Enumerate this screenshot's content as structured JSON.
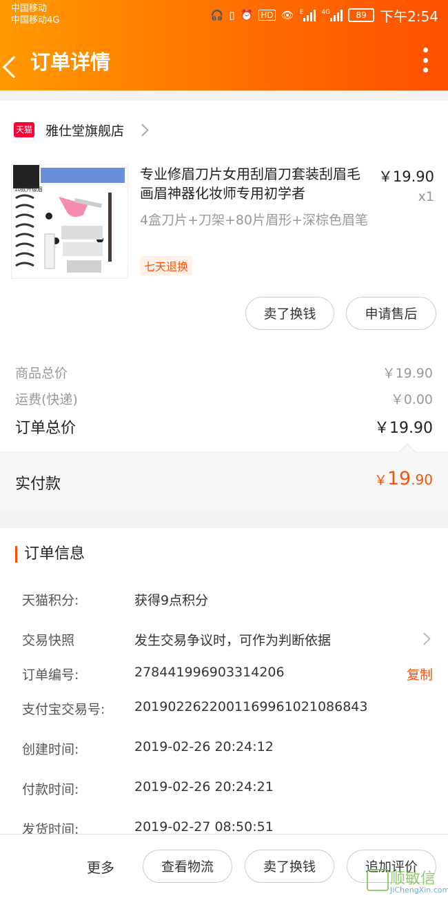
{
  "status_bar": {
    "carrier_1": "中国移动",
    "carrier_2": "中国移动4G",
    "hd": "HD",
    "net_e": "E",
    "net_4g": "4G",
    "battery": "89",
    "time": "下午2:54"
  },
  "nav": {
    "title": "订单详情"
  },
  "shop": {
    "badge": "天猫",
    "name": "雅仕堂旗舰店"
  },
  "product": {
    "title": "专业修眉刀片女用刮眉刀套装刮眉毛画眉神器化妆师专用初学者",
    "sku": "4盒刀片+刀架+80片眉形+深棕色眉笔",
    "tag": "七天退换",
    "price": "￥19.90",
    "qty": "x1",
    "image_text": "10款升级眉"
  },
  "item_actions": {
    "sell": "卖了换钱",
    "aftersale": "申请售后"
  },
  "summary": {
    "goods_label": "商品总价",
    "goods_value": "￥19.90",
    "shipping_label": "运费(快递)",
    "shipping_value": "￥0.00",
    "total_label": "订单总价",
    "total_value": "￥19.90",
    "paid_label": "实付款",
    "paid_currency": "￥",
    "paid_int": "19",
    "paid_dec": ".90"
  },
  "order_info": {
    "title": "订单信息",
    "rows": [
      {
        "k": "天猫积分:",
        "v": "获得9点积分"
      },
      {
        "k": "交易快照",
        "v": "发生交易争议时，可作为判断依据"
      },
      {
        "k": "订单编号:",
        "v": "278441996903314206",
        "action": "复制"
      },
      {
        "k": "支付宝交易号:",
        "v": "2019022622001169961021086843"
      },
      {
        "k": "创建时间:",
        "v": "2019-02-26 20:24:12"
      },
      {
        "k": "付款时间:",
        "v": "2019-02-26 20:24:21"
      },
      {
        "k": "发货时间:",
        "v": "2019-02-27 08:50:51"
      }
    ]
  },
  "bottom_bar": {
    "more": "更多",
    "logistics": "查看物流",
    "sell": "卖了换钱",
    "review": "追加评价"
  },
  "watermark": {
    "cn": "顺敏信",
    "en": "JiChengXin.com"
  },
  "colors": {
    "accent": "#ff5000",
    "topbar_start": "#ff9a00",
    "topbar_end": "#ff5000"
  }
}
